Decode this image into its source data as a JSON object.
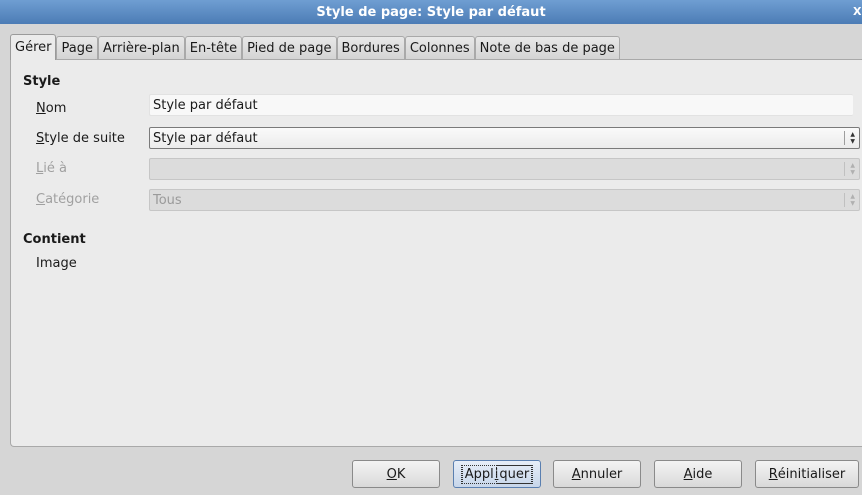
{
  "window": {
    "title": "Style de page: Style par défaut",
    "close_label": "X"
  },
  "tabs": [
    {
      "label": "Gérer",
      "active": true
    },
    {
      "label": "Page"
    },
    {
      "label": "Arrière-plan"
    },
    {
      "label": "En-tête"
    },
    {
      "label": "Pied de page"
    },
    {
      "label": "Bordures"
    },
    {
      "label": "Colonnes"
    },
    {
      "label": "Note de bas de page"
    }
  ],
  "style_section": {
    "heading": "Style",
    "name_label_u": "N",
    "name_label_rest": "om",
    "name_value": "Style par défaut",
    "next_label_u": "S",
    "next_label_rest": "tyle de suite",
    "next_value": "Style par défaut",
    "linked_label_u": "L",
    "linked_label_rest": "ié à",
    "linked_value": "",
    "category_label_u": "C",
    "category_label_rest": "atégorie",
    "category_value": "Tous"
  },
  "contains_section": {
    "heading": "Contient",
    "value": "Image"
  },
  "buttons": {
    "ok_u": "O",
    "ok_rest": "K",
    "apply_a": "Appl",
    "apply_u": "i",
    "apply_b": "quer",
    "cancel_u": "A",
    "cancel_rest": "nnuler",
    "help_u": "A",
    "help_rest": "ide",
    "reset_u": "R",
    "reset_rest": "éinitialiser"
  }
}
